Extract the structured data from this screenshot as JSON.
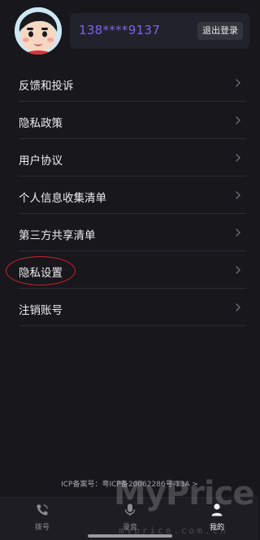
{
  "header": {
    "phone": "138****9137",
    "logout_label": "退出登录"
  },
  "menu": {
    "items": [
      {
        "label": "反馈和投诉",
        "icon": "chevron-right-icon"
      },
      {
        "label": "隐私政策",
        "icon": "chevron-right-icon"
      },
      {
        "label": "用户协议",
        "icon": "chevron-right-icon"
      },
      {
        "label": "个人信息收集清单",
        "icon": "chevron-right-icon"
      },
      {
        "label": "第三方共享清单",
        "icon": "chevron-right-icon"
      },
      {
        "label": "隐私设置",
        "icon": "chevron-right-icon",
        "highlighted": true
      },
      {
        "label": "注销账号",
        "icon": "chevron-right-icon"
      }
    ]
  },
  "footer": {
    "icp_text": "ICP备案号：粤ICP备20062286号-13A >"
  },
  "tabbar": {
    "tabs": [
      {
        "label": "拨号",
        "icon": "phone-dial-icon",
        "active": false
      },
      {
        "label": "录音",
        "icon": "microphone-icon",
        "active": false
      },
      {
        "label": "我的",
        "icon": "person-icon",
        "active": true
      }
    ]
  },
  "watermark": {
    "text": "MyPrice",
    "subtext": "myprice.com.cn"
  },
  "colors": {
    "background": "#17171c",
    "accent_phone": "#7c64e6",
    "highlight_ellipse": "#d4202a"
  }
}
